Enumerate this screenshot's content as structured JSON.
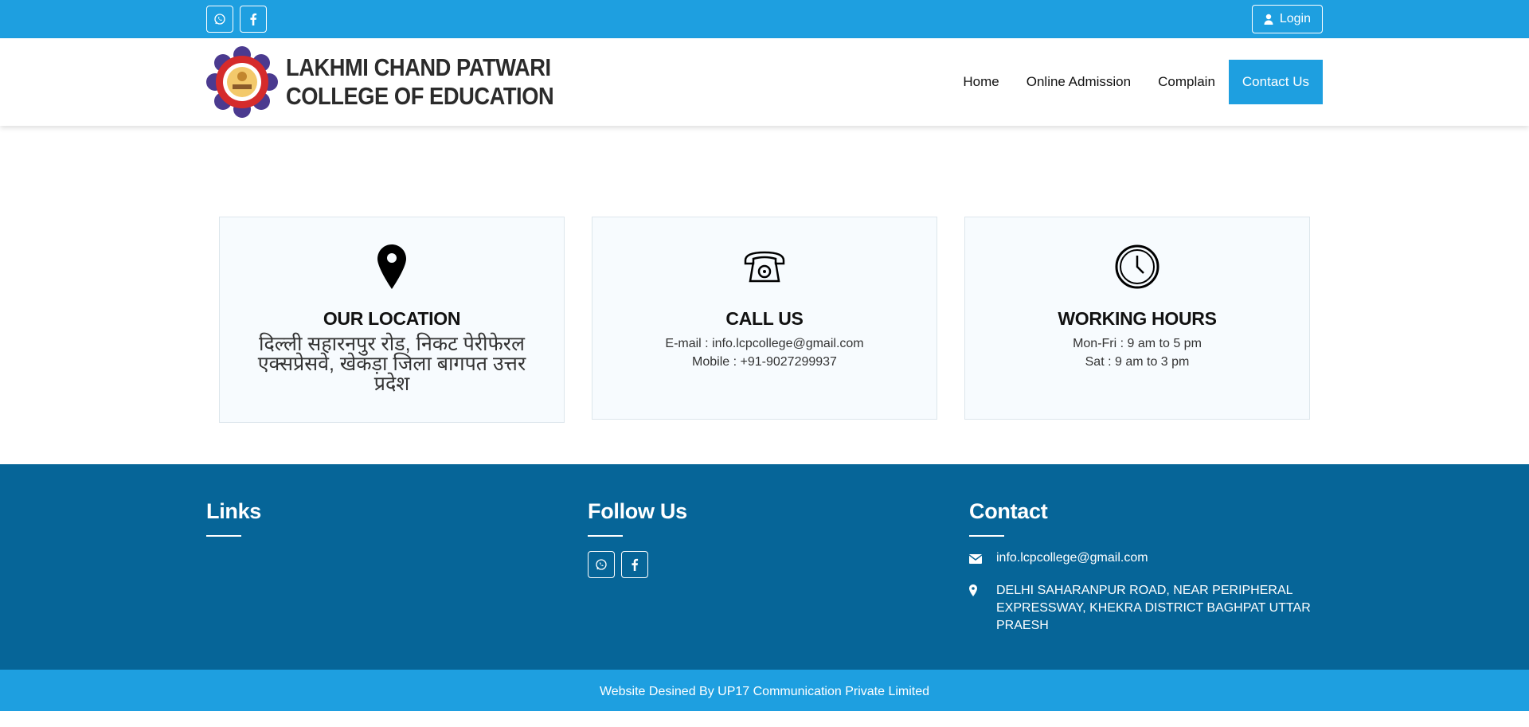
{
  "topbar": {
    "login_label": "Login",
    "social_icons": [
      "whatsapp-icon",
      "facebook-icon"
    ]
  },
  "header": {
    "logo_line1": "LAKHMI CHAND PATWARI",
    "logo_line2": "COLLEGE OF EDUCATION",
    "nav": [
      {
        "label": "Home",
        "active": false
      },
      {
        "label": "Online Admission",
        "active": false
      },
      {
        "label": "Complain",
        "active": false
      },
      {
        "label": "Contact Us",
        "active": true
      }
    ]
  },
  "cards": {
    "location": {
      "title": "OUR LOCATION",
      "text": "दिल्ली सहारनपुर रोड, निकट पेरीफेरल एक्सप्रेसवे, खेकड़ा जिला बागपत उत्तर प्रदेश"
    },
    "call": {
      "title": "CALL US",
      "email": "E-mail : info.lcpcollege@gmail.com",
      "mobile": "Mobile : +91-9027299937"
    },
    "hours": {
      "title": "WORKING HOURS",
      "weekday": "Mon-Fri : 9 am to 5 pm",
      "saturday": "Sat : 9 am to 3 pm"
    }
  },
  "footer": {
    "links_title": "Links",
    "follow_title": "Follow Us",
    "contact_title": "Contact",
    "email": "info.lcpcollege@gmail.com",
    "address": "DELHI SAHARANPUR ROAD, NEAR PERIPHERAL EXPRESSWAY, KHEKRA DISTRICT BAGHPAT UTTAR PRAESH",
    "credit": "Website Desined By UP17 Communication Private Limited"
  },
  "colors": {
    "primary": "#1e9fe0",
    "footer": "#066598",
    "card_bg": "#f7fbfe"
  }
}
